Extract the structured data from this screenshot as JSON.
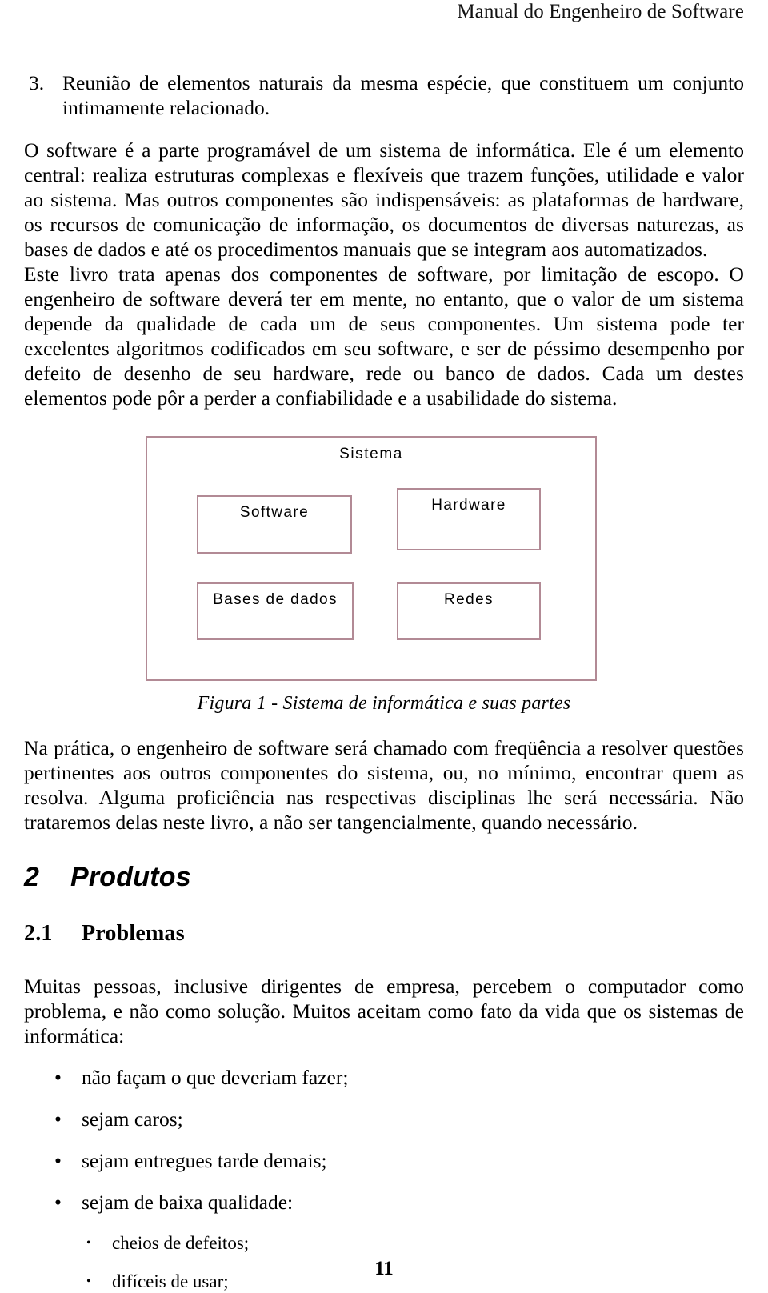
{
  "header": {
    "running_title": "Manual do Engenheiro de Software"
  },
  "numbered_item": {
    "number": "3.",
    "text": "Reunião de elementos naturais da mesma espécie, que constituem um conjunto intimamente relacionado."
  },
  "paragraphs": {
    "p1": "O software é a parte programável de um sistema de informática. Ele é um elemento central: realiza estruturas complexas e flexíveis que trazem funções, utilidade e valor ao sistema. Mas outros componentes são indispensáveis: as plataformas de hardware, os recursos de comunicação de informação, os documentos de diversas naturezas, as bases de dados e até os procedimentos manuais que se integram aos automatizados.",
    "p2": "Este livro trata apenas dos componentes de software, por limitação de escopo. O engenheiro de software deverá ter em mente, no entanto, que o valor de um sistema depende da qualidade de cada um de seus componentes. Um sistema pode ter excelentes algoritmos codificados em seu software, e ser de péssimo desempenho por defeito de desenho de seu hardware, rede ou banco de dados. Cada um destes elementos pode pôr a perder a confiabilidade e a usabilidade do sistema.",
    "p3": "Na prática, o engenheiro de software será chamado com freqüência a resolver questões pertinentes aos outros componentes do sistema, ou, no mínimo, encontrar quem as resolva. Alguma proficiência nas respectivas disciplinas lhe será necessária. Não trataremos delas neste livro, a não ser tangencialmente, quando necessário.",
    "p4": "Muitas pessoas, inclusive dirigentes de empresa, percebem o computador como problema, e não como solução. Muitos aceitam como fato da vida que os sistemas de informática:"
  },
  "figure": {
    "diagram_title": "Sistema",
    "nodes": [
      {
        "label": "Software"
      },
      {
        "label": "Hardware"
      },
      {
        "label": "Bases de dados"
      },
      {
        "label": "Redes"
      }
    ],
    "caption": "Figura 1 - Sistema de informática e suas partes",
    "border_color": "#b28a95"
  },
  "headings": {
    "section_number": "2",
    "section_title": "Produtos",
    "subsection_number": "2.1",
    "subsection_title": "Problemas"
  },
  "bullets": {
    "marker_level1": "•",
    "marker_level2": "•",
    "level1": [
      "não façam o que deveriam fazer;",
      "sejam caros;",
      "sejam entregues tarde demais;",
      "sejam de baixa qualidade:"
    ],
    "level2": [
      "cheios de defeitos;",
      "difíceis de usar;"
    ]
  },
  "footer": {
    "page_number": "11"
  }
}
